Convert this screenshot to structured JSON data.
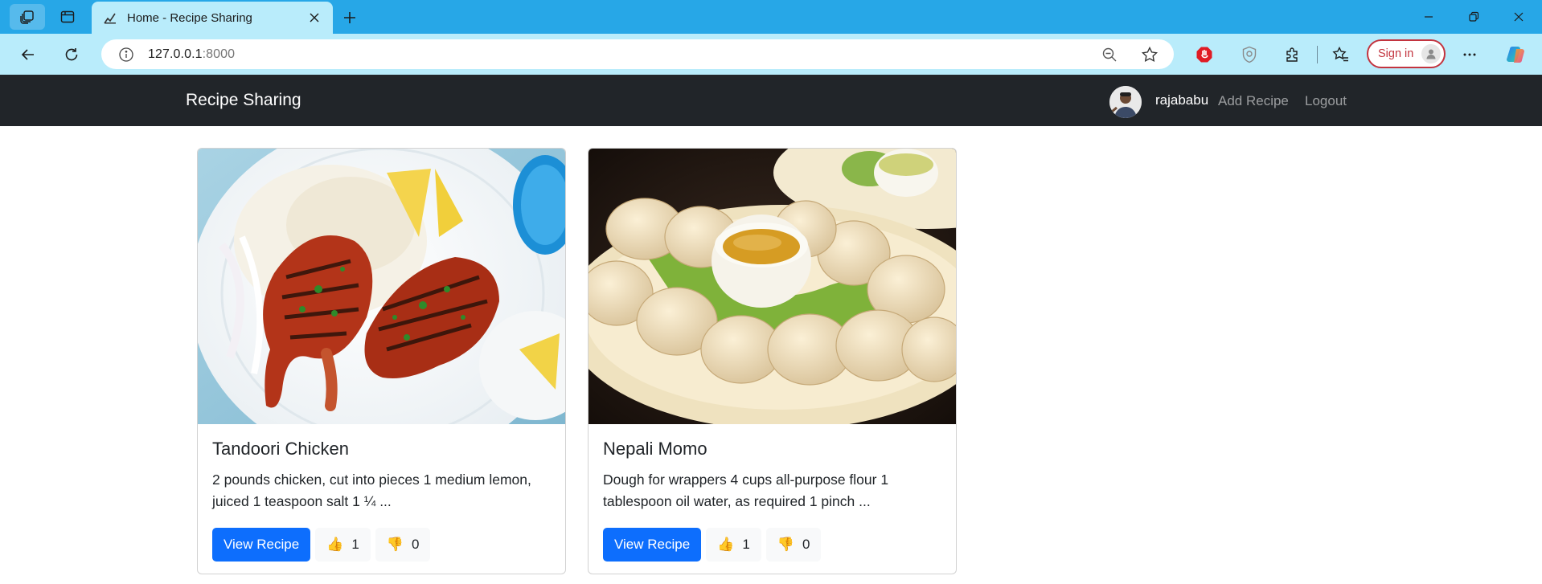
{
  "browser": {
    "tab_title": "Home - Recipe Sharing",
    "address_host": "127.0.0.1",
    "address_port": ":8000",
    "signin_label": "Sign in"
  },
  "navbar": {
    "brand": "Recipe Sharing",
    "username": "rajababu",
    "add_recipe": "Add Recipe",
    "logout": "Logout"
  },
  "recipes": [
    {
      "title": "Tandoori Chicken",
      "excerpt": "2 pounds chicken, cut into pieces 1 medium lemon, juiced 1 teaspoon salt 1 ¼ ...",
      "view_label": "View Recipe",
      "likes": "1",
      "dislikes": "0",
      "like_icon": "👍",
      "dislike_icon": "👎"
    },
    {
      "title": "Nepali Momo",
      "excerpt": "Dough for wrappers 4 cups all-purpose flour 1 tablespoon oil water, as required 1 pinch ...",
      "view_label": "View Recipe",
      "likes": "1",
      "dislikes": "0",
      "like_icon": "👍",
      "dislike_icon": "👎"
    }
  ],
  "colors": {
    "tabstrip": "#27a7e7",
    "toolbar": "#b9ecfb",
    "navbar": "#212529",
    "primary": "#0d6efd",
    "signin": "#c3343f"
  }
}
